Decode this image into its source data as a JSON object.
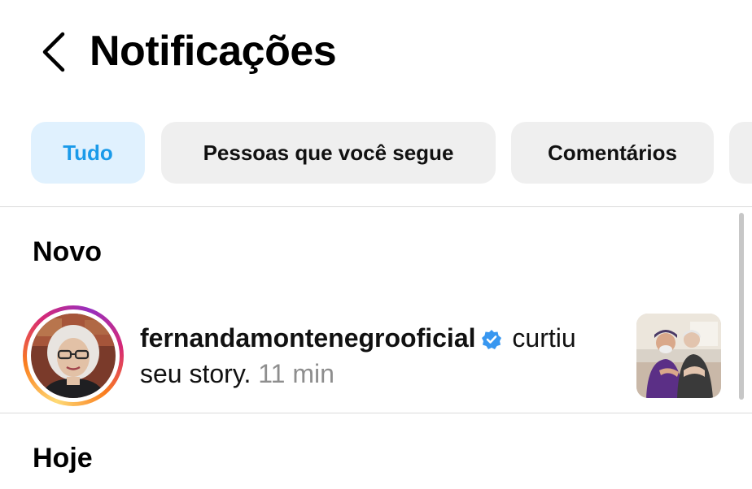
{
  "header": {
    "title": "Notificações",
    "back_icon": "chevron-left-icon"
  },
  "filters": {
    "chips": [
      {
        "label": "Tudo",
        "active": true
      },
      {
        "label": "Pessoas que você segue",
        "active": false
      },
      {
        "label": "Comentários",
        "active": false
      }
    ]
  },
  "sections": {
    "new_title": "Novo",
    "today_title": "Hoje"
  },
  "notifications": [
    {
      "username": "fernandamontenegrooficial",
      "verified": true,
      "action_text": " curtiu seu story.",
      "time": " 11 min",
      "avatar_icon": "profile-photo",
      "thumbnail_icon": "story-thumbnail"
    }
  ],
  "colors": {
    "accent_blue": "#1a9ae9",
    "active_chip_bg": "#e0f1fe",
    "chip_bg": "#efefef",
    "verified_blue": "#3897f0",
    "muted_text": "#8e8e8e"
  }
}
